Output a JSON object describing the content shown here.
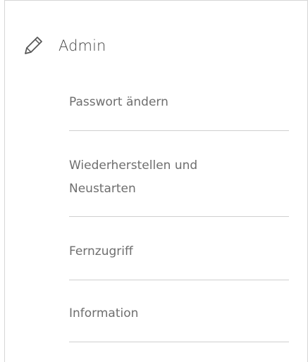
{
  "section": {
    "title": "Admin",
    "icon": "pencil-icon"
  },
  "menu": {
    "items": [
      {
        "label": "Passwort ändern"
      },
      {
        "label": "Wiederherstellen und Neustarten"
      },
      {
        "label": "Fernzugriff"
      },
      {
        "label": "Information"
      }
    ]
  },
  "colors": {
    "text": "#6e6e6e",
    "title": "#444444",
    "divider": "#cfcfcf",
    "border": "#d6d6d6"
  }
}
